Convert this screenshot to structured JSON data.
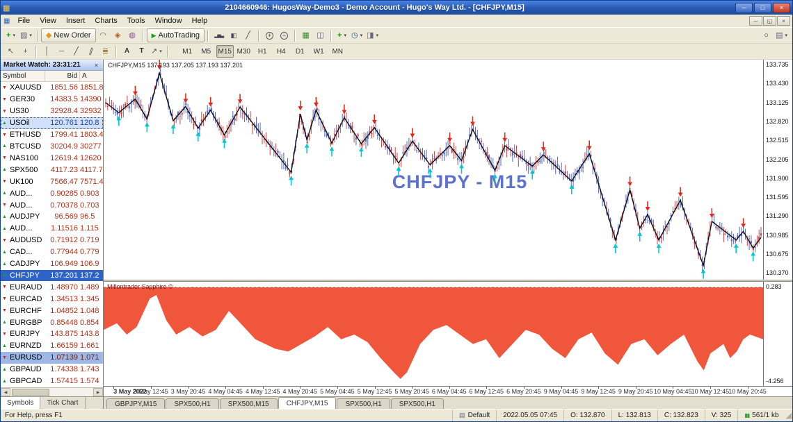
{
  "window": {
    "title": "2104660946: HugosWay-Demo3 - Demo Account - Hugo's Way Ltd. - [CHFJPY,M15]"
  },
  "menu": {
    "items": [
      "File",
      "View",
      "Insert",
      "Charts",
      "Tools",
      "Window",
      "Help"
    ]
  },
  "icons": {
    "app": "▦",
    "caret": "▾",
    "min": "─",
    "max": "□",
    "close": "×",
    "child-restore": "◱",
    "chart-plus": "+",
    "profiles": "▨",
    "order": "◆",
    "ea": "◠",
    "news": "◈",
    "alerts": "◍",
    "play": "▶",
    "bars": "▂▅▃",
    "candles": "▮▯",
    "line": "╱",
    "zoom-in": "+",
    "zoom-out": "−",
    "tile": "▦",
    "arrange": "◫",
    "indicators": "+",
    "clock": "◷",
    "template": "◨",
    "search": "○",
    "print": "▤",
    "cursor": "↖",
    "crosshair": "+",
    "vline": "│",
    "hline": "─",
    "trend": "╱",
    "channel": "∥",
    "fibo": "≣",
    "text": "A",
    "label": "T",
    "arrows": "↗",
    "up": "▲",
    "down": "▼",
    "left": "◀",
    "right": "▶",
    "grip": "◢",
    "doc": "▤",
    "net": "▮▮"
  },
  "toolbar": {
    "groups": [
      [
        {
          "name": "new-chart",
          "icon": "chart-plus",
          "caret": true
        },
        {
          "name": "profiles",
          "icon": "profiles",
          "caret": true
        }
      ],
      [
        {
          "name": "new-order",
          "icon": "order",
          "label": "New Order"
        },
        {
          "name": "expert-advisors",
          "icon": "ea"
        },
        {
          "name": "news",
          "icon": "news"
        },
        {
          "name": "alerts",
          "icon": "alerts"
        }
      ],
      [
        {
          "name": "autotrading",
          "icon": "play",
          "label": "AutoTrading"
        }
      ],
      [
        {
          "name": "bar-chart",
          "icon": "bars"
        },
        {
          "name": "candlestick-chart",
          "icon": "candles"
        },
        {
          "name": "line-chart",
          "icon": "line"
        }
      ],
      [
        {
          "name": "zoom-in",
          "icon": "zoom-in"
        },
        {
          "name": "zoom-out",
          "icon": "zoom-out"
        }
      ],
      [
        {
          "name": "tile-windows",
          "icon": "tile"
        },
        {
          "name": "arrange-windows",
          "icon": "arrange"
        }
      ],
      [
        {
          "name": "indicators",
          "icon": "indicators",
          "caret": true
        },
        {
          "name": "periods",
          "icon": "clock",
          "caret": true
        },
        {
          "name": "templates",
          "icon": "template",
          "caret": true
        }
      ]
    ],
    "right_buttons": [
      {
        "name": "search",
        "icon": "search"
      },
      {
        "name": "print",
        "icon": "print",
        "caret": true
      }
    ],
    "line_tools": [
      {
        "name": "cursor",
        "icon": "cursor"
      },
      {
        "name": "crosshair",
        "icon": "crosshair"
      },
      {
        "sep": true
      },
      {
        "name": "vertical-line",
        "icon": "vline"
      },
      {
        "name": "horizontal-line",
        "icon": "hline"
      },
      {
        "name": "trendline",
        "icon": "trend"
      },
      {
        "name": "channel",
        "icon": "channel"
      },
      {
        "name": "fibonacci",
        "icon": "fibo"
      },
      {
        "sep": true
      },
      {
        "name": "text",
        "icon": "text"
      },
      {
        "name": "label",
        "icon": "label"
      },
      {
        "name": "arrows",
        "icon": "arrows",
        "caret": true
      },
      {
        "sep": true
      }
    ],
    "timeframes": [
      "M1",
      "M5",
      "M15",
      "M30",
      "H1",
      "H4",
      "D1",
      "W1",
      "MN"
    ],
    "active_timeframe": "M15"
  },
  "market_watch": {
    "title": "Market Watch: 23:31:21",
    "columns": [
      "Symbol",
      "Bid",
      "A"
    ],
    "tabs": [
      "Symbols",
      "Tick Chart"
    ],
    "active_tab": "Symbols",
    "rows": [
      {
        "symbol": "XAUUSD",
        "bid": "1851.56",
        "ask": "1851.8",
        "dir": "down",
        "sel": ""
      },
      {
        "symbol": "GER30",
        "bid": "14383.5",
        "ask": "14390",
        "dir": "down",
        "sel": ""
      },
      {
        "symbol": "US30",
        "bid": "32928.4",
        "ask": "32932",
        "dir": "down",
        "sel": ""
      },
      {
        "symbol": "USOil",
        "bid": "120.761",
        "ask": "120.8",
        "dir": "up",
        "sel": "light"
      },
      {
        "symbol": "ETHUSD",
        "bid": "1799.41",
        "ask": "1803.4",
        "dir": "down",
        "sel": ""
      },
      {
        "symbol": "BTCUSD",
        "bid": "30204.9",
        "ask": "30277",
        "dir": "up",
        "sel": ""
      },
      {
        "symbol": "NAS100",
        "bid": "12619.4",
        "ask": "12620",
        "dir": "down",
        "sel": ""
      },
      {
        "symbol": "SPX500",
        "bid": "4117.23",
        "ask": "4117.7",
        "dir": "up",
        "sel": ""
      },
      {
        "symbol": "UK100",
        "bid": "7566.47",
        "ask": "7571.4",
        "dir": "down",
        "sel": ""
      },
      {
        "symbol": "AUD...",
        "bid": "0.90285",
        "ask": "0.903",
        "dir": "up",
        "sel": ""
      },
      {
        "symbol": "AUD...",
        "bid": "0.70378",
        "ask": "0.703",
        "dir": "down",
        "sel": ""
      },
      {
        "symbol": "AUDJPY",
        "bid": "96.569",
        "ask": "96.5",
        "dir": "up",
        "sel": ""
      },
      {
        "symbol": "AUD...",
        "bid": "1.11516",
        "ask": "1.115",
        "dir": "up",
        "sel": ""
      },
      {
        "symbol": "AUDUSD",
        "bid": "0.71912",
        "ask": "0.719",
        "dir": "down",
        "sel": ""
      },
      {
        "symbol": "CAD...",
        "bid": "0.77944",
        "ask": "0.779",
        "dir": "up",
        "sel": ""
      },
      {
        "symbol": "CADJPY",
        "bid": "106.949",
        "ask": "106.9",
        "dir": "up",
        "sel": ""
      },
      {
        "symbol": "CHFJPY",
        "bid": "137.201",
        "ask": "137.2",
        "dir": "up",
        "sel": "active"
      },
      {
        "symbol": "EURAUD",
        "bid": "1.48970",
        "ask": "1.489",
        "dir": "down",
        "sel": ""
      },
      {
        "symbol": "EURCAD",
        "bid": "1.34513",
        "ask": "1.345",
        "dir": "down",
        "sel": ""
      },
      {
        "symbol": "EURCHF",
        "bid": "1.04852",
        "ask": "1.048",
        "dir": "down",
        "sel": ""
      },
      {
        "symbol": "EURGBP",
        "bid": "0.85448",
        "ask": "0.854",
        "dir": "up",
        "sel": ""
      },
      {
        "symbol": "EURJPY",
        "bid": "143.875",
        "ask": "143.8",
        "dir": "down",
        "sel": ""
      },
      {
        "symbol": "EURNZD",
        "bid": "1.66159",
        "ask": "1.661",
        "dir": "up",
        "sel": ""
      },
      {
        "symbol": "EURUSD",
        "bid": "1.07139",
        "ask": "1.071",
        "dir": "down",
        "sel": "mid"
      },
      {
        "symbol": "GBPAUD",
        "bid": "1.74338",
        "ask": "1.743",
        "dir": "up",
        "sel": ""
      },
      {
        "symbol": "GBPCAD",
        "bid": "1.57415",
        "ask": "1.574",
        "dir": "up",
        "sel": ""
      }
    ]
  },
  "chart": {
    "header": "CHFJPY,M15  137.193 137.205 137.193 137.201",
    "watermark": "CHFJPY - M15",
    "indicator_name": "Millontrader Sapphire ©",
    "indicator_max": "0.283",
    "indicator_min": "-4.256",
    "price_labels": [
      "133.735",
      "133.430",
      "133.125",
      "132.820",
      "132.515",
      "132.205",
      "131.900",
      "131.595",
      "131.290",
      "130.985",
      "130.675",
      "130.370"
    ],
    "time_labels": [
      "3 May 2022",
      "3 May 12:45",
      "3 May 20:45",
      "4 May 04:45",
      "4 May 12:45",
      "4 May 20:45",
      "5 May 04:45",
      "5 May 12:45",
      "5 May 20:45",
      "6 May 04:45",
      "6 May 12:45",
      "6 May 20:45",
      "9 May 04:45",
      "9 May 12:45",
      "9 May 20:45",
      "10 May 04:45",
      "10 May 12:45",
      "10 May 20:45"
    ],
    "tabs": [
      "GBPJPY,M15",
      "SPX500,H1",
      "SPX500,M15",
      "CHFJPY,M15",
      "SPX500,H1",
      "SPX500,H1"
    ],
    "active_tab_index": 3
  },
  "colors": {
    "bull": "#5566cc",
    "bear": "#cc4444",
    "zigzag": "#101018",
    "sell_arrow": "#e02a1a",
    "buy_arrow": "#00c8cc",
    "indicator_fill": "#f0563b",
    "watermark": "#5c72cc",
    "selection_blue": "#2f63c8"
  },
  "chart_data": {
    "type": "line",
    "title": "CHFJPY M15 price with ZigZag swing line, sell (red down) / buy (cyan up) arrows, and Millontrader Sapphire area indicator",
    "price_axis": {
      "min": 130.27,
      "max": 133.81,
      "tick_step": 0.305,
      "ticks": [
        133.735,
        133.43,
        133.125,
        132.82,
        132.515,
        132.205,
        131.9,
        131.595,
        131.29,
        130.985,
        130.675,
        130.37
      ]
    },
    "zigzag_format": "[time_fraction, price]; interior local maxima = sell arrows, minima = buy arrows",
    "zigzag": [
      [
        0.0,
        133.12
      ],
      [
        0.02,
        132.96
      ],
      [
        0.045,
        133.18
      ],
      [
        0.063,
        132.86
      ],
      [
        0.082,
        133.6
      ],
      [
        0.103,
        132.83
      ],
      [
        0.122,
        133.06
      ],
      [
        0.141,
        132.71
      ],
      [
        0.16,
        133.0
      ],
      [
        0.181,
        132.6
      ],
      [
        0.205,
        133.05
      ],
      [
        0.283,
        132.0
      ],
      [
        0.297,
        132.94
      ],
      [
        0.307,
        132.52
      ],
      [
        0.321,
        133.0
      ],
      [
        0.345,
        132.47
      ],
      [
        0.364,
        132.88
      ],
      [
        0.39,
        132.46
      ],
      [
        0.41,
        132.72
      ],
      [
        0.447,
        132.15
      ],
      [
        0.468,
        132.5
      ],
      [
        0.495,
        132.12
      ],
      [
        0.525,
        132.43
      ],
      [
        0.543,
        132.19
      ],
      [
        0.56,
        132.69
      ],
      [
        0.594,
        132.03
      ],
      [
        0.609,
        132.43
      ],
      [
        0.651,
        132.1
      ],
      [
        0.668,
        132.28
      ],
      [
        0.711,
        131.86
      ],
      [
        0.738,
        132.3
      ],
      [
        0.778,
        130.91
      ],
      [
        0.8,
        131.72
      ],
      [
        0.815,
        131.1
      ],
      [
        0.827,
        131.32
      ],
      [
        0.844,
        130.91
      ],
      [
        0.877,
        131.55
      ],
      [
        0.912,
        130.5
      ],
      [
        0.925,
        131.21
      ],
      [
        0.962,
        130.91
      ],
      [
        0.973,
        131.05
      ],
      [
        0.988,
        130.78
      ],
      [
        1.0,
        130.95
      ]
    ],
    "indicator_range": [
      0.283,
      -4.256
    ],
    "indicator_format": "[time_fraction, depth_fraction 0..1 below top baseline]",
    "indicator_area": [
      [
        0.0,
        0.45
      ],
      [
        0.02,
        0.38
      ],
      [
        0.035,
        0.5
      ],
      [
        0.05,
        0.42
      ],
      [
        0.07,
        0.12
      ],
      [
        0.08,
        0.08
      ],
      [
        0.095,
        0.35
      ],
      [
        0.11,
        0.5
      ],
      [
        0.13,
        0.42
      ],
      [
        0.15,
        0.52
      ],
      [
        0.17,
        0.45
      ],
      [
        0.19,
        0.25
      ],
      [
        0.21,
        0.4
      ],
      [
        0.23,
        0.55
      ],
      [
        0.26,
        0.65
      ],
      [
        0.28,
        0.68
      ],
      [
        0.3,
        0.6
      ],
      [
        0.32,
        0.52
      ],
      [
        0.34,
        0.42
      ],
      [
        0.36,
        0.55
      ],
      [
        0.38,
        0.5
      ],
      [
        0.4,
        0.58
      ],
      [
        0.42,
        0.75
      ],
      [
        0.44,
        0.9
      ],
      [
        0.45,
        0.97
      ],
      [
        0.46,
        0.9
      ],
      [
        0.48,
        0.6
      ],
      [
        0.5,
        0.45
      ],
      [
        0.52,
        0.4
      ],
      [
        0.54,
        0.5
      ],
      [
        0.56,
        0.6
      ],
      [
        0.58,
        0.55
      ],
      [
        0.6,
        0.75
      ],
      [
        0.62,
        0.6
      ],
      [
        0.64,
        0.45
      ],
      [
        0.66,
        0.5
      ],
      [
        0.68,
        0.65
      ],
      [
        0.7,
        0.75
      ],
      [
        0.72,
        0.55
      ],
      [
        0.74,
        0.48
      ],
      [
        0.76,
        0.7
      ],
      [
        0.78,
        0.82
      ],
      [
        0.8,
        0.6
      ],
      [
        0.82,
        0.55
      ],
      [
        0.84,
        0.72
      ],
      [
        0.86,
        0.6
      ],
      [
        0.88,
        0.5
      ],
      [
        0.9,
        0.78
      ],
      [
        0.91,
        0.88
      ],
      [
        0.92,
        0.7
      ],
      [
        0.94,
        0.6
      ],
      [
        0.95,
        0.75
      ],
      [
        0.96,
        0.68
      ],
      [
        0.97,
        0.55
      ],
      [
        0.98,
        0.5
      ],
      [
        1.0,
        0.55
      ]
    ]
  },
  "statusbar": {
    "help": "For Help, press F1",
    "profile": "Default",
    "bar_time": "2022.05.05 07:45",
    "open": "O: 132.870",
    "low": "L: 132.813",
    "close": "C: 132.823",
    "volume": "V: 325",
    "net": "561/1 kb"
  }
}
